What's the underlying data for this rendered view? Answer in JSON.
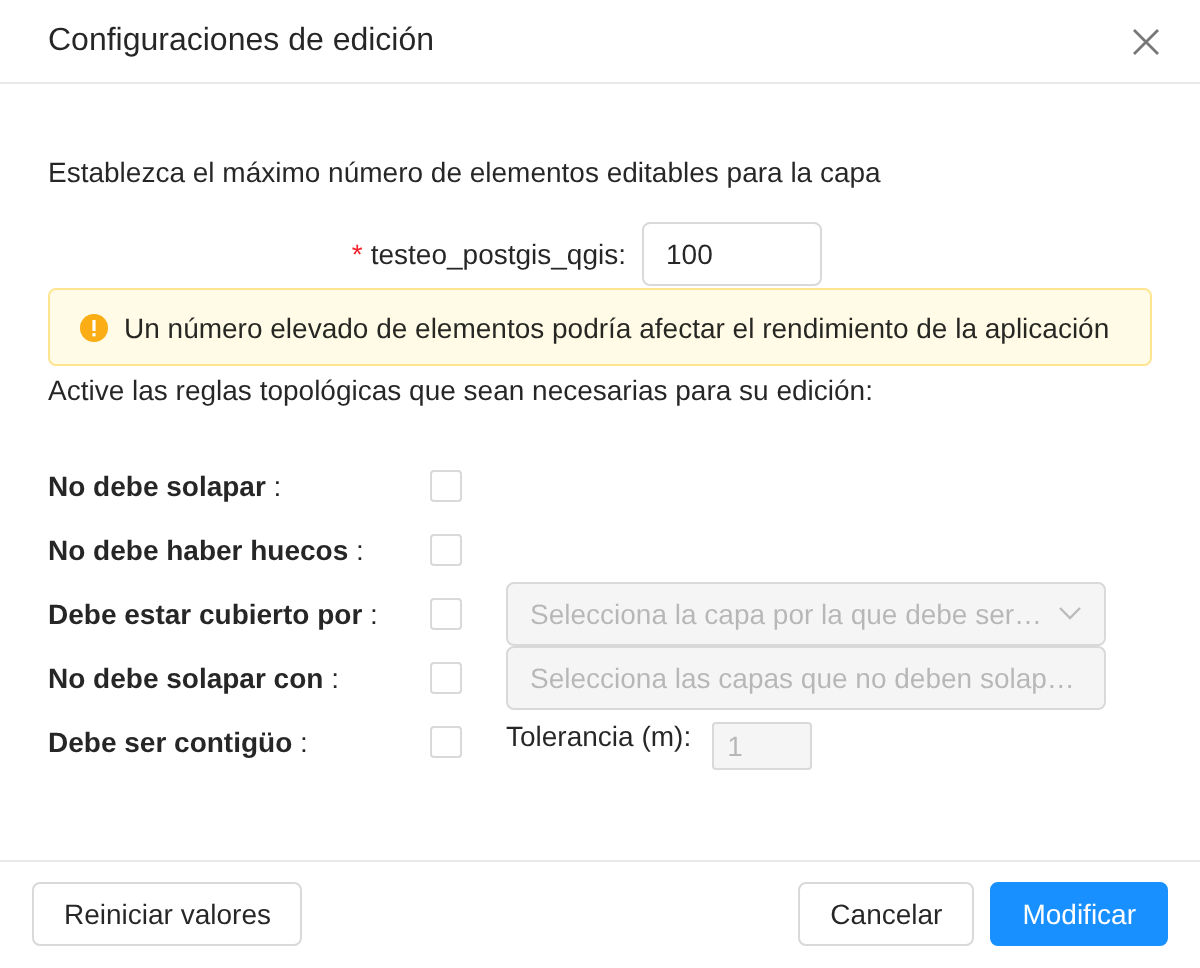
{
  "dialog": {
    "title": "Configuraciones de edición"
  },
  "intro": "Establezca el máximo número de elementos editables para la capa",
  "limit_field": {
    "required_mark": "*",
    "label": "testeo_postgis_qgis:",
    "value": "100"
  },
  "alert": {
    "text": "Un número elevado de elementos podría afectar el rendimiento de la aplicación"
  },
  "rules_intro": "Active las reglas topológicas que sean necesarias para su edición:",
  "rules": [
    {
      "label": "**No debe solapar** :",
      "checked": false,
      "kind": "plain"
    },
    {
      "label": "**No debe haber huecos** :",
      "checked": false,
      "kind": "plain"
    },
    {
      "label": "**Debe estar cubierto por** :",
      "checked": false,
      "kind": "select",
      "placeholder": "Selecciona la capa por la que debe ser…",
      "disabled": true
    },
    {
      "label": "**No debe solapar con** :",
      "checked": false,
      "kind": "multiselect",
      "placeholder": "Selecciona las capas que no deben solap…",
      "disabled": true
    },
    {
      "label": "**Debe ser contigüo** :",
      "checked": false,
      "kind": "number",
      "field_label": "Tolerancia (m):",
      "value": "1",
      "disabled": true
    }
  ],
  "buttons": [
    {
      "label": "Reiniciar valores",
      "kind": "default"
    },
    {
      "label": "Cancelar",
      "kind": "default"
    },
    {
      "label": "Modificar",
      "kind": "primary"
    }
  ]
}
